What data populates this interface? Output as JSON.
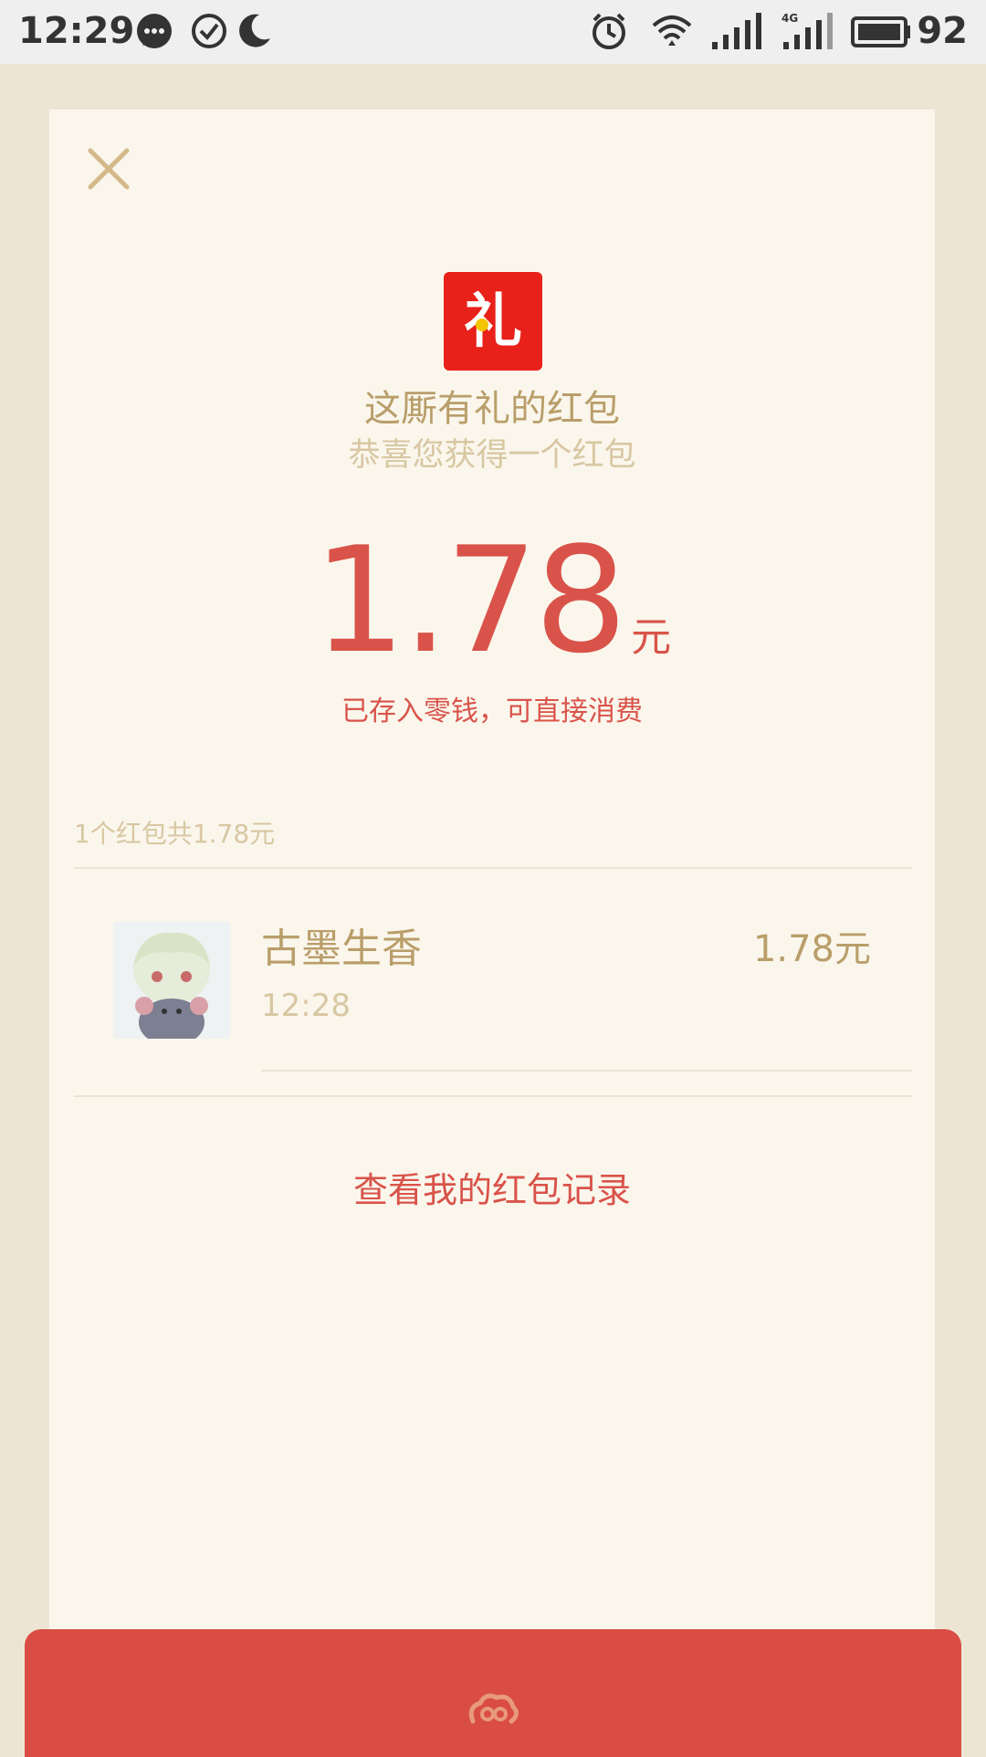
{
  "status_bar": {
    "time": "12:29",
    "battery": "92",
    "icons": [
      "message-icon",
      "check-circle-icon",
      "moon-icon",
      "alarm-icon",
      "wifi-icon",
      "signal-icon",
      "4g-signal-icon",
      "battery-icon"
    ]
  },
  "card": {
    "logo_char": "礼",
    "title": "这厮有礼的红包",
    "subtitle": "恭喜您获得一个红包",
    "amount": "1.78",
    "amount_unit": "元",
    "deposit_note": "已存入零钱，可直接消费",
    "summary": "1个红包共1.78元",
    "record": {
      "name": "古墨生香",
      "time": "12:28",
      "amount": "1.78元"
    },
    "history_link": "查看我的红包记录"
  },
  "colors": {
    "accent_red": "#d9534a",
    "gold_text": "#b99e6a",
    "light_gold": "#d8c7a2",
    "card_bg": "#faf6ec",
    "page_bg": "#ede5d4"
  }
}
